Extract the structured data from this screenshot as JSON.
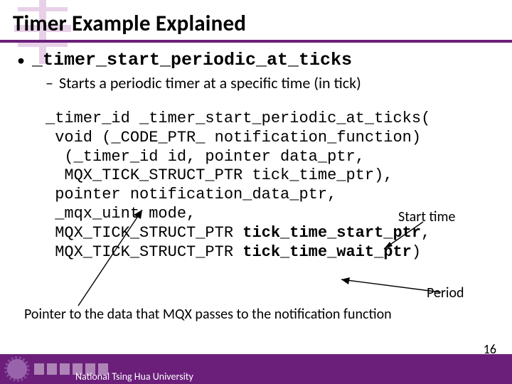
{
  "title": "Timer Example Explained",
  "bullet": {
    "function_name": "_timer_start_periodic_at_ticks",
    "description": "Starts a periodic timer at a specific time (in tick)"
  },
  "code": {
    "line1": "_timer_id _timer_start_periodic_at_ticks(",
    "line2": " void (_CODE_PTR_ notification_function)",
    "line3": "  (_timer_id id, pointer data_ptr,",
    "line4": "  MQX_TICK_STRUCT_PTR tick_time_ptr),",
    "line5": " pointer notification_data_ptr,",
    "line6": " _mqx_uint mode,",
    "line7_a": " MQX_TICK_STRUCT_PTR ",
    "line7_b": "tick_time_start_ptr",
    "line7_c": ",",
    "line8_a": " MQX_TICK_STRUCT_PTR ",
    "line8_b": "tick_time_wait_ptr",
    "line8_c": ")"
  },
  "annotations": {
    "start_time": "Start time",
    "period": "Period",
    "pointer_desc": "Pointer to the data that MQX passes to the notification function"
  },
  "footer": {
    "university": "National Tsing Hua University"
  },
  "page_number": "16"
}
